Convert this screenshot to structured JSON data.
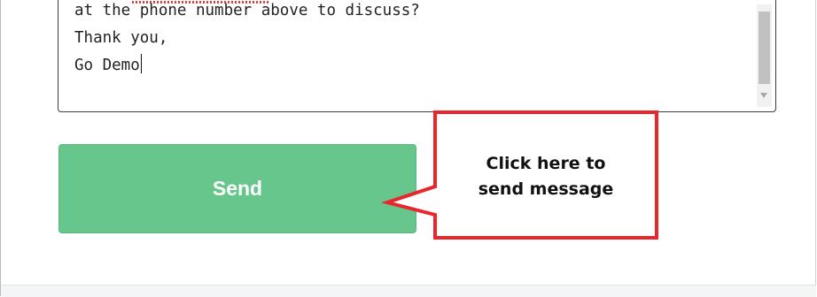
{
  "message": {
    "lines": [
      "at the phone number above to discuss?",
      "Thank you,",
      "Go Demo"
    ]
  },
  "send_button": {
    "label": "Send",
    "color": "#67c68c"
  },
  "callout": {
    "text": "Click here to\nsend message",
    "border_color": "#e8262b"
  },
  "icons": [
    "scroll-down-arrow-icon",
    "text-cursor-icon"
  ]
}
